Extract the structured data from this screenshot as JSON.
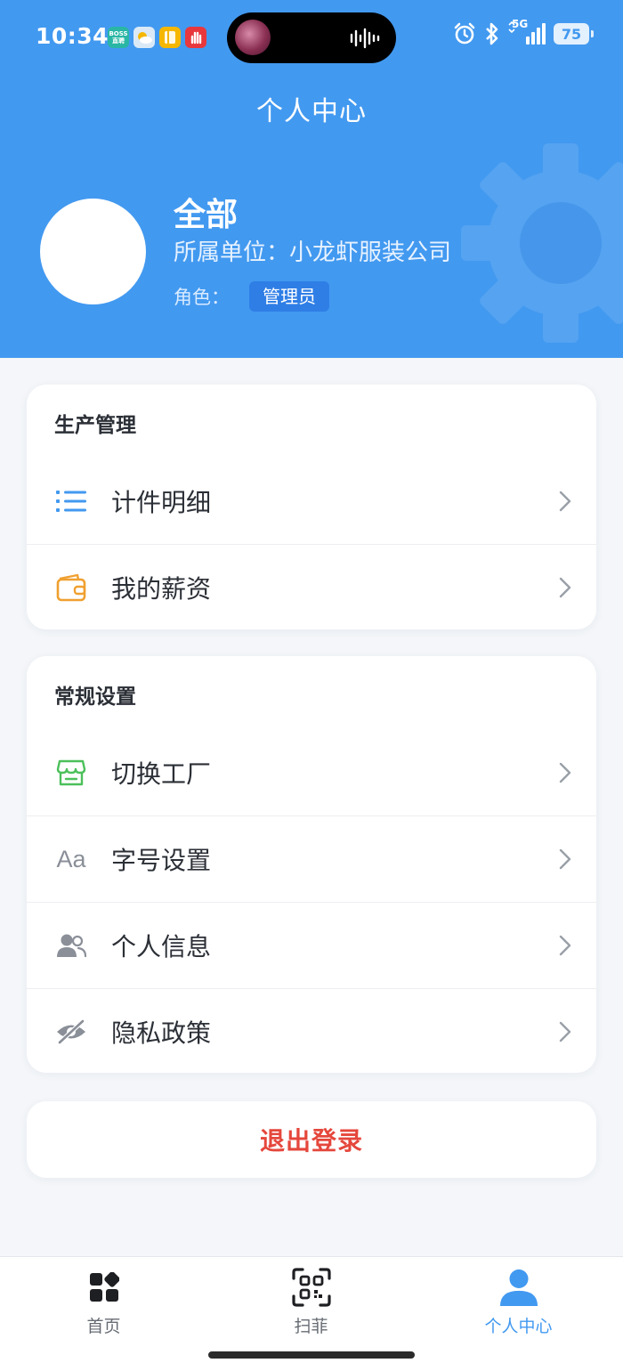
{
  "status_bar": {
    "time": "10:34",
    "app_icons": [
      {
        "name": "boss-app-icon",
        "label": "BOSS\n直聘",
        "color": "#29b6a5"
      },
      {
        "name": "weather-app-icon",
        "label": "",
        "color": "#6ab5f5"
      },
      {
        "name": "notes-app-icon",
        "label": "",
        "color": "#f5b700"
      },
      {
        "name": "hand-app-icon",
        "label": "",
        "color": "#e8383d"
      }
    ],
    "network": "5G",
    "battery": "75"
  },
  "header": {
    "title": "个人中心",
    "user_name": "全部",
    "unit_line": "所属单位：小龙虾服装公司",
    "role_label": "角色：",
    "role_badge": "管理员",
    "bg_color": "#4299f0"
  },
  "sections": [
    {
      "title": "生产管理",
      "items": [
        {
          "label": "计件明细",
          "icon": "list-icon",
          "icon_color": "#4299f0"
        },
        {
          "label": "我的薪资",
          "icon": "wallet-icon",
          "icon_color": "#f0a030"
        }
      ]
    },
    {
      "title": "常规设置",
      "items": [
        {
          "label": "切换工厂",
          "icon": "store-icon",
          "icon_color": "#4cc05a"
        },
        {
          "label": "字号设置",
          "icon": "font-size-icon",
          "icon_text": "Aa",
          "icon_color": "#8a8f98"
        },
        {
          "label": "个人信息",
          "icon": "users-icon",
          "icon_color": "#8a8f98"
        },
        {
          "label": "隐私政策",
          "icon": "eye-off-icon",
          "icon_color": "#8a8f98"
        }
      ]
    }
  ],
  "logout": {
    "label": "退出登录",
    "color": "#e5473c"
  },
  "tabbar": {
    "tabs": [
      {
        "label": "首页",
        "icon": "apps-grid-icon",
        "active": false
      },
      {
        "label": "扫菲",
        "icon": "qr-scan-icon",
        "active": false
      },
      {
        "label": "个人中心",
        "icon": "person-icon",
        "active": true
      }
    ],
    "active_color": "#4299f0"
  }
}
